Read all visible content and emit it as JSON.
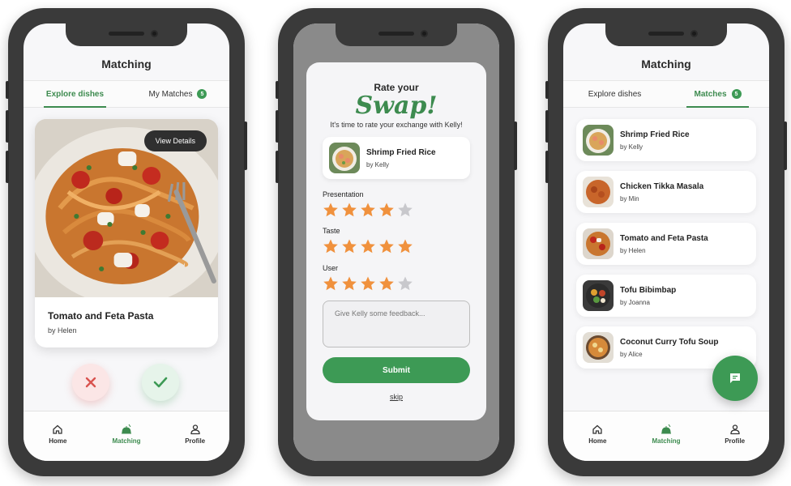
{
  "phone1": {
    "title": "Matching",
    "tabs": [
      {
        "label": "Explore dishes",
        "active": true
      },
      {
        "label": "My Matches",
        "badge": "5",
        "active": false
      }
    ],
    "card": {
      "view_details": "View Details",
      "name": "Tomato and Feta Pasta",
      "by": "by Helen"
    },
    "actions": {
      "reject_icon": "close-icon",
      "accept_icon": "check-icon"
    }
  },
  "phone2": {
    "heading": "Rate your",
    "brand": "Swap!",
    "subtitle": "It's time to rate your exchange with Kelly!",
    "exchange": {
      "name": "Shrimp Fried Rice",
      "by": "by Kelly"
    },
    "ratings": [
      {
        "label": "Presentation",
        "value": 4,
        "max": 5
      },
      {
        "label": "Taste",
        "value": 5,
        "max": 5
      },
      {
        "label": "User",
        "value": 4,
        "max": 5
      }
    ],
    "feedback_placeholder": "Give Kelly some feedback...",
    "submit": "Submit",
    "skip": "skip"
  },
  "phone3": {
    "title": "Matching",
    "tabs": [
      {
        "label": "Explore dishes",
        "active": false
      },
      {
        "label": "Matches",
        "badge": "5",
        "active": true
      }
    ],
    "matches": [
      {
        "name": "Shrimp Fried Rice",
        "by": "by Kelly"
      },
      {
        "name": "Chicken Tikka Masala",
        "by": "by Min"
      },
      {
        "name": "Tomato and Feta Pasta",
        "by": "by Helen"
      },
      {
        "name": "Tofu Bibimbap",
        "by": "by Joanna"
      },
      {
        "name": "Coconut Curry Tofu Soup",
        "by": "by Alice"
      }
    ],
    "fab_icon": "chat-icon"
  },
  "nav": [
    {
      "label": "Home",
      "icon": "home-icon"
    },
    {
      "label": "Matching",
      "icon": "matching-icon"
    },
    {
      "label": "Profile",
      "icon": "profile-icon"
    }
  ],
  "colors": {
    "accent": "#3d8b4f",
    "star": "#f0913d",
    "star_empty": "#c8c8cc",
    "reject": "#d9534f"
  }
}
